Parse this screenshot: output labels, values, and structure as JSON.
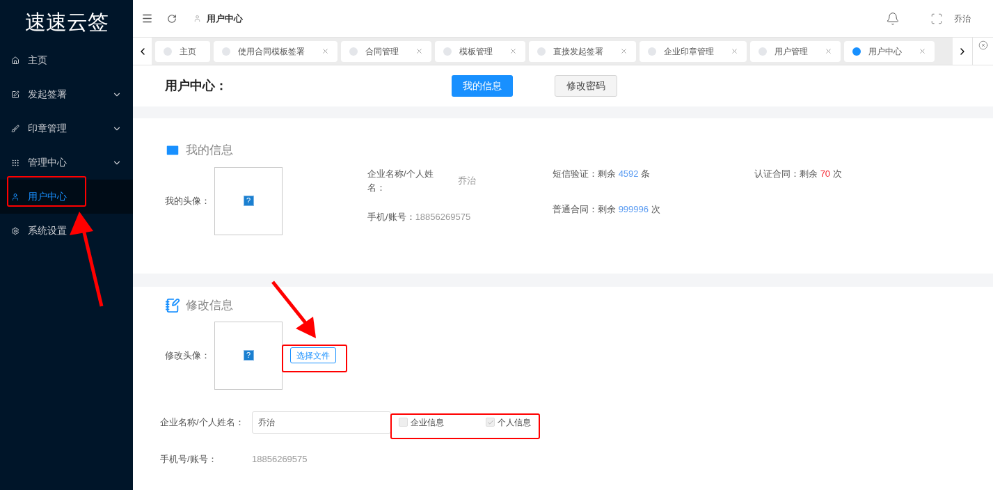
{
  "sidebar": {
    "logo": "速速云签",
    "items": [
      {
        "kind": "home",
        "label": "主页",
        "selected": false,
        "has_submenu": false
      },
      {
        "kind": "edit",
        "label": "发起签署",
        "selected": false,
        "has_submenu": true
      },
      {
        "kind": "brush",
        "label": "印章管理",
        "selected": false,
        "has_submenu": true
      },
      {
        "kind": "grid",
        "label": "管理中心",
        "selected": false,
        "has_submenu": true
      },
      {
        "kind": "user",
        "label": "用户中心",
        "selected": true,
        "has_submenu": false
      },
      {
        "kind": "gear",
        "label": "系统设置",
        "selected": false,
        "has_submenu": false
      }
    ]
  },
  "header": {
    "breadcrumb": "用户中心",
    "user": "乔治"
  },
  "tabs": [
    {
      "label": "主页",
      "selected": false,
      "closable": false
    },
    {
      "label": "使用合同模板签署",
      "selected": false,
      "closable": true
    },
    {
      "label": "合同管理",
      "selected": false,
      "closable": true
    },
    {
      "label": "模板管理",
      "selected": false,
      "closable": true
    },
    {
      "label": "直接发起签署",
      "selected": false,
      "closable": true
    },
    {
      "label": "企业印章管理",
      "selected": false,
      "closable": true
    },
    {
      "label": "用户管理",
      "selected": false,
      "closable": true
    },
    {
      "label": "用户中心",
      "selected": true,
      "closable": true
    }
  ],
  "page": {
    "title": "用户中心：",
    "buttons": [
      {
        "label": "我的信息",
        "selected": true
      },
      {
        "label": "修改密码",
        "selected": false
      }
    ]
  },
  "my_info": {
    "title": "我的信息",
    "avatar_label": "我的头像：",
    "avatar_icon": "?",
    "name_label": "企业名称/个人姓名：",
    "name_value": "乔治",
    "phone_label": "手机/账号：",
    "phone_value": "18856269575",
    "quotas": [
      {
        "label": "短信验证：",
        "prefix": "剩余",
        "value": "4592",
        "unit": "条",
        "color": "#5b9cf2"
      },
      {
        "label": "认证合同：",
        "prefix": "剩余",
        "value": "70",
        "unit": "次",
        "color": "#f5222d"
      },
      {
        "label": "普通合同：",
        "prefix": "剩余",
        "value": "999996",
        "unit": "次",
        "color": "#5b9cf2"
      }
    ]
  },
  "edit_info": {
    "title": "修改信息",
    "avatar_label": "修改头像：",
    "avatar_icon": "?",
    "file_button": "选择文件",
    "name_label": "企业名称/个人姓名：",
    "name_value": "乔治",
    "options": [
      {
        "label": "企业信息",
        "checked": false
      },
      {
        "label": "个人信息",
        "checked": true
      }
    ],
    "phone_label": "手机号/账号：",
    "phone_value": "18856269575"
  }
}
